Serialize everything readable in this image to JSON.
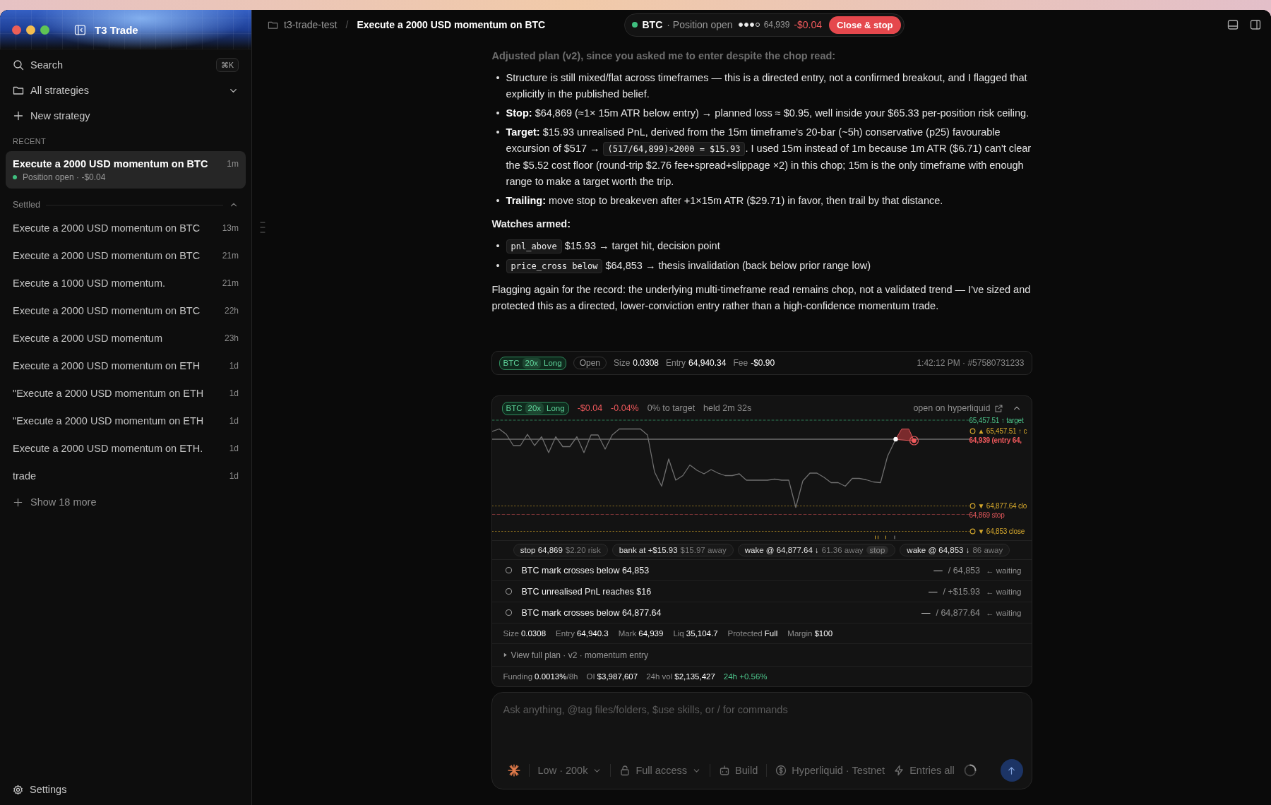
{
  "sidebar": {
    "app_title": "T3 Trade",
    "search": {
      "label": "Search",
      "shortcut": "⌘K"
    },
    "nav": [
      {
        "kind": "folder",
        "label": "All strategies"
      },
      {
        "kind": "new",
        "label": "New strategy"
      }
    ],
    "recent_heading": "RECENT",
    "recent": [
      {
        "title": "Execute a 2000 USD momentum on BTC",
        "time": "1m",
        "status": "Position open · -$0.04",
        "selected": true
      }
    ],
    "settled_heading": "Settled",
    "settled_expanded": true,
    "settled": [
      {
        "title": "Execute a 2000 USD momentum on BTC",
        "time": "13m",
        "selected": false
      },
      {
        "title": "Execute a 2000 USD momentum on BTC",
        "time": "21m",
        "selected": false
      },
      {
        "title": "Execute a 1000 USD momentum.",
        "time": "21m",
        "selected": false
      },
      {
        "title": "Execute a 2000 USD momentum on BTC",
        "time": "22h",
        "selected": false
      },
      {
        "title": "Execute a 2000 USD momentum",
        "time": "23h",
        "selected": false
      },
      {
        "title": "Execute a 2000 USD momentum on ETH",
        "time": "1d",
        "selected": false
      },
      {
        "title": "\"Execute a 2000 USD momentum on ETH",
        "time": "1d",
        "selected": false
      },
      {
        "title": "\"Execute a 2000 USD momentum on ETH",
        "time": "1d",
        "selected": false
      },
      {
        "title": "Execute a 2000 USD momentum on ETH.",
        "time": "1d",
        "selected": false
      },
      {
        "title": "trade",
        "time": "1d",
        "selected": false
      }
    ],
    "show_more": "Show 18 more",
    "settings": "Settings"
  },
  "topbar": {
    "folder": "t3-trade-test",
    "separator": "/",
    "title": "Execute a 2000 USD momentum on BTC",
    "status": {
      "symbol": "BTC",
      "state": "· Position open",
      "stars": 3,
      "mark": "64,939",
      "pnl": "-$0.04",
      "action": "Close & stop"
    }
  },
  "message": {
    "heading": "Adjusted plan (v2), since you asked me to enter despite the chop read:",
    "bullet_marker": "•",
    "bullets": [
      [
        {
          "kind": "text",
          "text": "Structure is still mixed/flat across timeframes — this is a directed entry, not a confirmed breakout, and I flagged that explicitly in the published belief."
        }
      ],
      [
        {
          "kind": "text",
          "text": "**Stop:** $64,869 (≈1× 15m ATR below entry) → planned loss ≈ $0.95, well inside your $65.33 per-position risk ceiling."
        }
      ],
      [
        {
          "kind": "text",
          "text": "**Target:** $15.93 unrealised PnL, derived from the 15m timeframe's 20-bar (~5h) conservative (p25) favourable excursion of $517 → "
        },
        {
          "kind": "code",
          "text": "(517/64,899)×2000 = $15.93"
        },
        {
          "kind": "text",
          "text": ". I used 15m instead of 1m because 1m ATR ($6.71) can't clear the $5.52 cost floor (round-trip $2.76 fee+spread+slippage ×2) in this chop; 15m is the only timeframe with enough range to make a target worth the trip."
        }
      ],
      [
        {
          "kind": "text",
          "text": "**Trailing:** move stop to breakeven after +1×15m ATR ($29.71) in favor, then trail by that distance."
        }
      ]
    ],
    "watches_heading": "Watches armed:",
    "watches": [
      {
        "code": "pnl_above",
        "text": "$15.93 → target hit, decision point"
      },
      {
        "code": "price_cross below",
        "text": "$64,853 → thesis invalidation (back below prior range low)"
      }
    ],
    "closing": "Flagging again for the record: the underlying multi-timeframe read remains chop, not a validated trend — I've sized and protected this as a directed, lower-conviction entry rather than a high-confidence momentum trade."
  },
  "position_bar": {
    "tag": {
      "symbol": "BTC",
      "leverage": "20x",
      "side": "Long"
    },
    "status": "Open",
    "fields": [
      {
        "label": "Size",
        "value": "0.0308"
      },
      {
        "label": "Entry",
        "value": "64,940.34"
      },
      {
        "label": "Fee",
        "value": "-$0.90"
      }
    ],
    "meta": "1:42:12 PM · #57580731233"
  },
  "position_card": {
    "tag": {
      "symbol": "BTC",
      "leverage": "20x",
      "side": "Long"
    },
    "pnl": "-$0.04",
    "pnl_pct": "-0.04%",
    "to_target": "0% to target",
    "held": "held 2m 32s",
    "link": "open on hyperliquid",
    "expanded": true,
    "levels": [
      {
        "kind": "target",
        "label": "65,457.51 ↑ target"
      },
      {
        "kind": "alert",
        "label": "▲ 65,457.51 ↑ c"
      },
      {
        "kind": "entry",
        "label": "64,939 (entry 64,"
      },
      {
        "kind": "alert",
        "label": "▼ 64,877.64 clo"
      },
      {
        "kind": "stop",
        "label": "64,869 stop"
      },
      {
        "kind": "alert",
        "label": "▼ 64,853 close"
      }
    ],
    "chips": [
      {
        "text": "stop 64,869",
        "detail": "$2.20 risk"
      },
      {
        "text": "bank at +$15.93",
        "detail": "$15.97 away"
      },
      {
        "text": "wake @ 64,877.64 ↓",
        "detail": "61.36 away",
        "tag": "stop"
      },
      {
        "text": "wake @ 64,853 ↓",
        "detail": "86 away"
      }
    ],
    "watches": [
      {
        "label": "BTC mark crosses below 64,853",
        "current": "—",
        "target": "/ 64,853",
        "status": "← waiting",
        "triggered": false
      },
      {
        "label": "BTC unrealised PnL reaches $16",
        "current": "—",
        "target": "/ +$15.93",
        "status": "← waiting",
        "triggered": false
      },
      {
        "label": "BTC mark crosses below 64,877.64",
        "current": "—",
        "target": "/ 64,877.64",
        "status": "← waiting",
        "triggered": false
      }
    ],
    "stats": [
      {
        "label": "Size",
        "value": "0.0308"
      },
      {
        "label": "Entry",
        "value": "64,940.3"
      },
      {
        "label": "Mark",
        "value": "64,939"
      },
      {
        "label": "Liq",
        "value": "35,104.7"
      },
      {
        "label": "Protected",
        "value": "Full"
      },
      {
        "label": "Margin",
        "value": "$100"
      }
    ],
    "plan": {
      "label": "View full plan · v2 · momentum entry",
      "expanded": false
    },
    "market": [
      {
        "kind": "stat",
        "label": "Funding",
        "value": "0.0013%",
        "unit": "/8h"
      },
      {
        "kind": "stat",
        "label": "OI",
        "value": "$3,987,607"
      },
      {
        "kind": "stat",
        "label": "24h vol",
        "value": "$2,135,427"
      },
      {
        "kind": "change",
        "value": "24h +0.56%"
      }
    ]
  },
  "composer": {
    "placeholder": "Ask anything, @tag files/folders, $use skills, or / for commands",
    "tools": [
      {
        "kind": "effort",
        "label": "Low · 200k",
        "menu": true
      },
      {
        "kind": "access",
        "label": "Full access",
        "menu": true
      },
      {
        "kind": "build",
        "label": "Build",
        "menu": false
      },
      {
        "kind": "network",
        "label": "Hyperliquid · Testnet",
        "menu": false
      },
      {
        "kind": "entries",
        "label": "Entries all",
        "menu": false
      }
    ]
  }
}
